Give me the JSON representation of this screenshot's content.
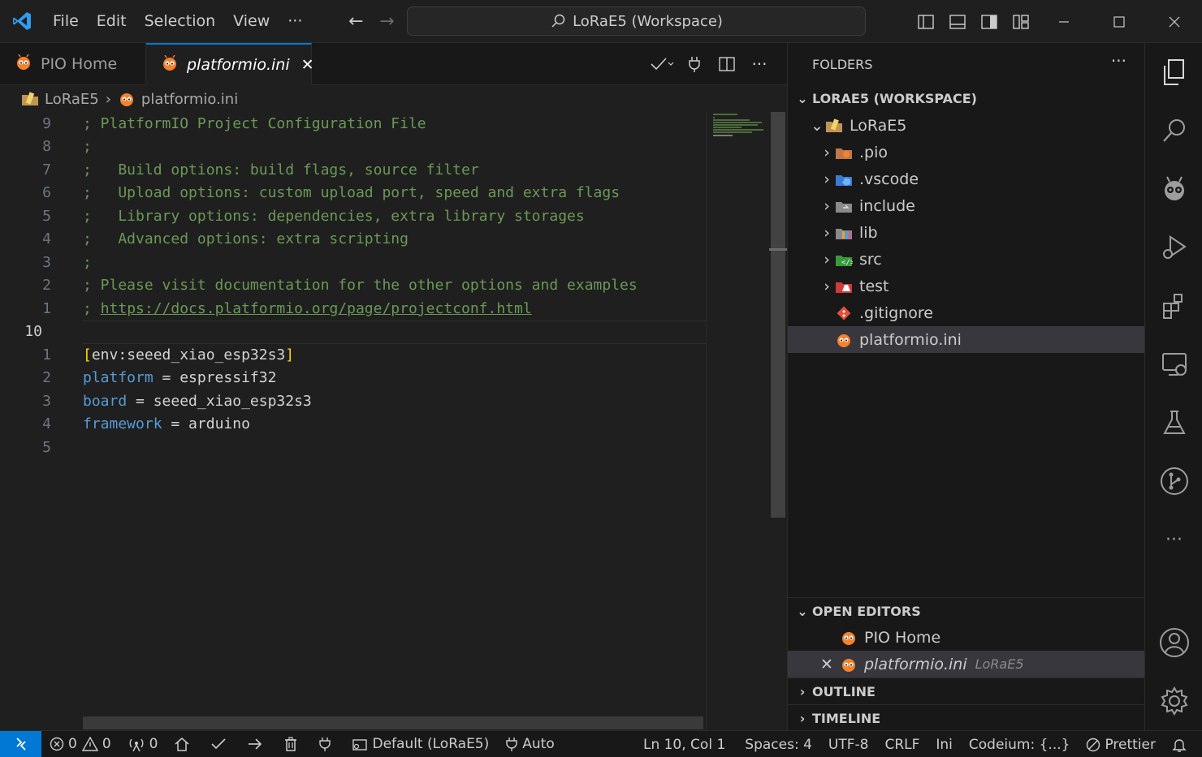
{
  "titlebar": {
    "menu": [
      "File",
      "Edit",
      "Selection",
      "View",
      "···"
    ],
    "command_center": "LoRaE5 (Workspace)"
  },
  "tabs": [
    {
      "label": "PIO Home",
      "active": false
    },
    {
      "label": "platformio.ini",
      "active": true
    }
  ],
  "breadcrumb": {
    "folder": "LoRaE5",
    "file": "platformio.ini"
  },
  "editor": {
    "lines": [
      {
        "num": "9",
        "text": "; PlatformIO Project Configuration File"
      },
      {
        "num": "8",
        "text": ";"
      },
      {
        "num": "7",
        "text": ";   Build options: build flags, source filter"
      },
      {
        "num": "6",
        "text": ";   Upload options: custom upload port, speed and extra flags"
      },
      {
        "num": "5",
        "text": ";   Library options: dependencies, extra library storages"
      },
      {
        "num": "4",
        "text": ";   Advanced options: extra scripting"
      },
      {
        "num": "3",
        "text": ";"
      },
      {
        "num": "2",
        "text": "; Please visit documentation for the other options and examples"
      },
      {
        "num": "1",
        "text": "; ",
        "link": "https://docs.platformio.org/page/projectconf.html"
      },
      {
        "num": "10",
        "text": ""
      },
      {
        "num": "1",
        "text": "[env:seeed_xiao_esp32s3]"
      },
      {
        "num": "2",
        "key": "platform",
        "value": " = espressif32"
      },
      {
        "num": "3",
        "key": "board",
        "value": " = seeed_xiao_esp32s3"
      },
      {
        "num": "4",
        "key": "framework",
        "value": " = arduino"
      },
      {
        "num": "5",
        "text": ""
      }
    ]
  },
  "sidebar": {
    "header": "FOLDERS",
    "more": "···",
    "workspace": "LORAE5 (WORKSPACE)",
    "root_folder": "LoRaE5",
    "items": [
      ".pio",
      ".vscode",
      "include",
      "lib",
      "src",
      "test",
      ".gitignore",
      "platformio.ini"
    ],
    "open_editors_title": "OPEN EDITORS",
    "open_editors": [
      {
        "label": "PIO Home",
        "desc": ""
      },
      {
        "label": "platformio.ini",
        "desc": "LoRaE5"
      }
    ],
    "outline_title": "OUTLINE",
    "timeline_title": "TIMELINE"
  },
  "statusbar": {
    "errors": "0",
    "warnings": "0",
    "ports": "0",
    "env": "Default (LoRaE5)",
    "auto": "Auto",
    "position": "Ln 10, Col 1",
    "spaces": "Spaces: 4",
    "encoding": "UTF-8",
    "eol": "CRLF",
    "language": "Ini",
    "codeium": "Codeium: {...}",
    "prettier": "Prettier"
  },
  "colors": {
    "accent": "#0078d4",
    "comment": "#6a9955",
    "key": "#569cd6",
    "bracket": "#ffd700"
  }
}
